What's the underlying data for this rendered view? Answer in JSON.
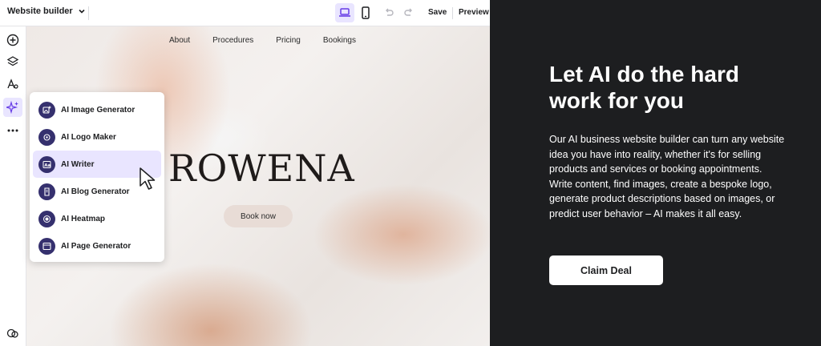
{
  "toolbar": {
    "site_label": "Website builder",
    "save_label": "Save",
    "preview_label": "Preview"
  },
  "canvas": {
    "nav": [
      "About",
      "Procedures",
      "Pricing",
      "Bookings"
    ],
    "brand": "ROWENA",
    "cta": "Book now"
  },
  "ai_menu": {
    "items": [
      {
        "label": "AI Image Generator",
        "icon": "image-plus-icon"
      },
      {
        "label": "AI Logo Maker",
        "icon": "logo-icon"
      },
      {
        "label": "AI Writer",
        "icon": "text-icon"
      },
      {
        "label": "AI Blog Generator",
        "icon": "blog-icon"
      },
      {
        "label": "AI Heatmap",
        "icon": "heatmap-icon"
      },
      {
        "label": "AI Page Generator",
        "icon": "page-icon"
      }
    ],
    "hovered_index": 2
  },
  "promo": {
    "headline": "Let AI do the hard work for you",
    "description": "Our AI business website builder can turn any website idea you have into reality, whether it's for selling products and services or booking appointments. Write content, find images, create a bespoke logo, generate product descriptions based on images, or predict user behavior – AI makes it all easy.",
    "button": "Claim Deal"
  },
  "colors": {
    "accent_light": "#e9e5ff",
    "accent_dark": "#35306e",
    "dark_bg": "#1d1e20"
  }
}
